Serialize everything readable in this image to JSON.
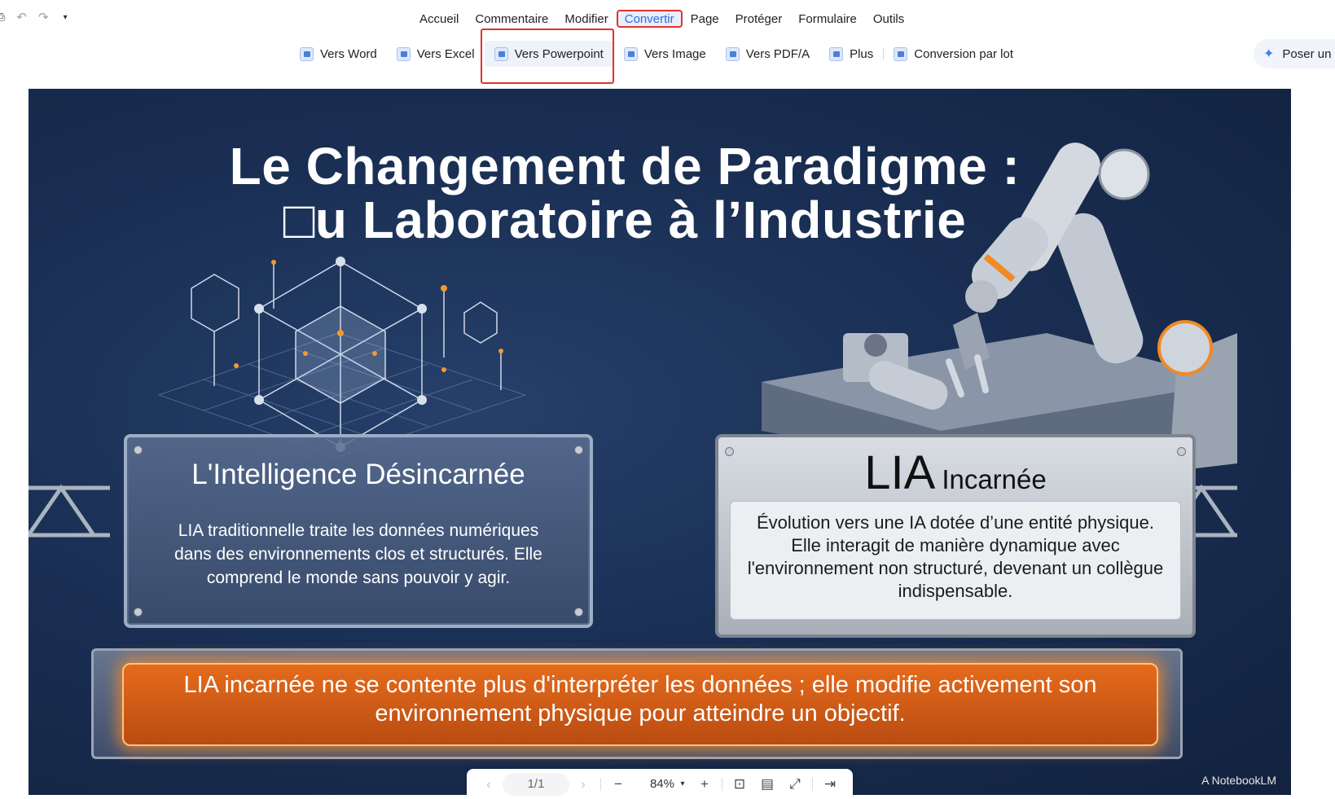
{
  "quick_access": {
    "undo_icon": "undo-icon",
    "redo_icon": "redo-icon",
    "dropdown": "▾"
  },
  "menu": {
    "tabs": [
      "Accueil",
      "Commentaire",
      "Modifier",
      "Convertir",
      "Page",
      "Protéger",
      "Formulaire",
      "Outils"
    ],
    "active": "Convertir"
  },
  "ribbon": {
    "items": [
      "Vers Word",
      "Vers Excel",
      "Vers Powerpoint",
      "Vers Image",
      "Vers PDF/A",
      "Plus",
      "Conversion par lot"
    ],
    "selected": "Vers Powerpoint"
  },
  "ask_button": {
    "label": "Poser un"
  },
  "slide": {
    "title_line1": "Le Changement de Paradigme :",
    "title_line2": "□u Laboratoire à l’Industrie",
    "left_card": {
      "title": "L'Intelligence Désincarnée",
      "body": "LIA traditionnelle traite les données numériques dans des environnements clos et structurés. Elle comprend le monde sans pouvoir y agir."
    },
    "right_card": {
      "title_big": "LIA",
      "title_small": "Incarnée",
      "body": "Évolution vers une IA dotée d’une entité physique. Elle interagit de manière dynamique avec l'environnement non structuré, devenant un collègue indispensable."
    },
    "banner": "LIA incarnée ne se contente plus d'interpréter les données ; elle modifie activement son environnement physique pour atteindre un objectif.",
    "credit": "A NotebookLM"
  },
  "bottom_bar": {
    "page": "1/1",
    "zoom": "84%",
    "dropdown": "▾",
    "minus": "−",
    "plus": "+"
  },
  "colors": {
    "accent": "#2b6de4",
    "highlight_border": "#e0332f",
    "slide_bg": "#1a2f54",
    "banner": "#e56b1c"
  }
}
